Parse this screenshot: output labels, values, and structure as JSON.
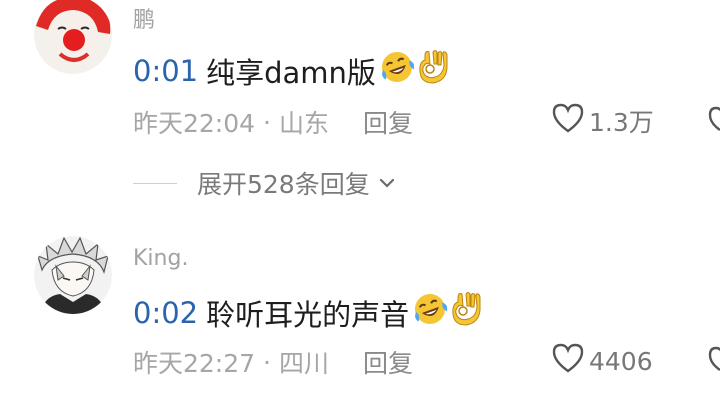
{
  "comments": [
    {
      "username": "鹏",
      "timestamp": "0:01",
      "text": "纯享damn版",
      "date": "昨天22:04",
      "location": "山东",
      "reply_label": "回复",
      "likes": "1.3万"
    },
    {
      "username": "King.",
      "timestamp": "0:02",
      "text": "聆听耳光的声音",
      "date": "昨天22:27",
      "location": "四川",
      "reply_label": "回复",
      "likes": "4406"
    }
  ],
  "expand_replies": "展开528条回复",
  "separator": "·",
  "colors": {
    "timestamp_link": "#2a64ad",
    "meta": "#a6a6a6",
    "username": "#a2a2a2"
  },
  "icons": {
    "laugh": "laughing-tears-emoji",
    "ok": "ok-hand-emoji",
    "heart": "heart-outline-icon",
    "chevron": "chevron-down-icon"
  }
}
